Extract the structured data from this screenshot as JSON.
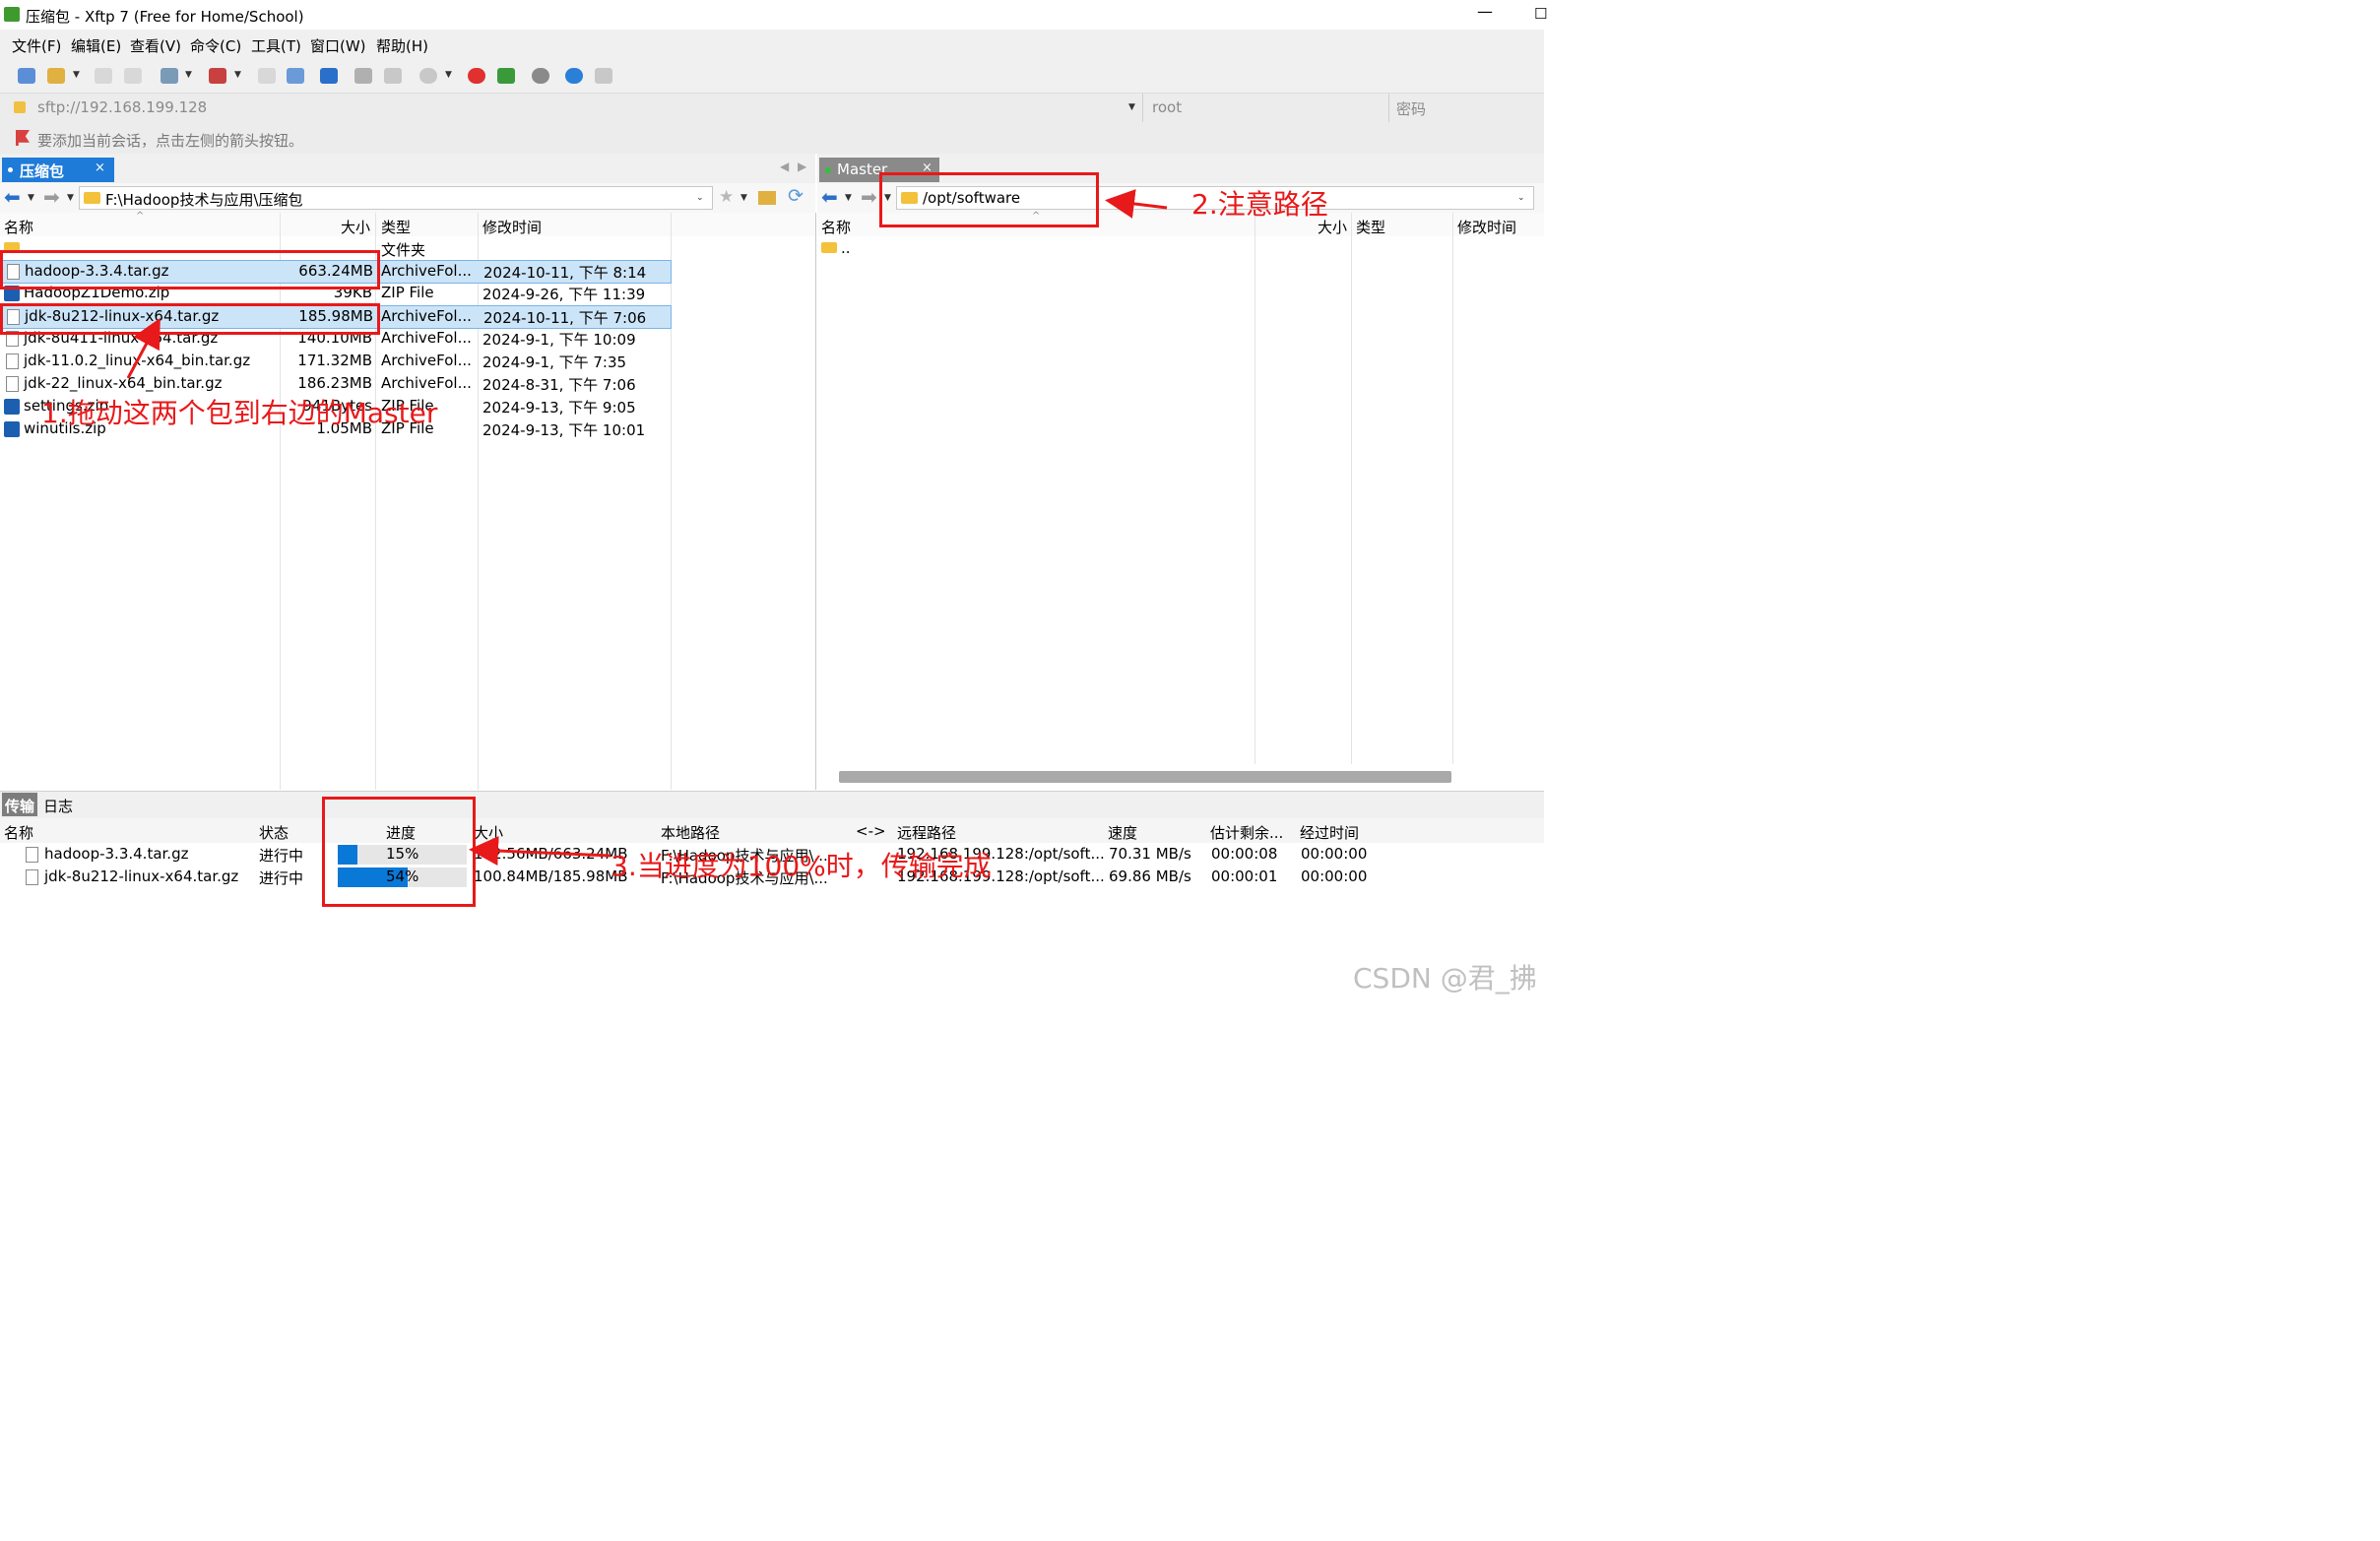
{
  "window": {
    "title": "压缩包 - Xftp 7 (Free for Home/School)",
    "minimize": "—",
    "maximize": "☐"
  },
  "menu": [
    "文件(F)",
    "编辑(E)",
    "查看(V)",
    "命令(C)",
    "工具(T)",
    "窗口(W)",
    "帮助(H)"
  ],
  "toolbar_icons": [
    "new-session-icon",
    "open-folder-icon",
    "connect-icon",
    "disconnect-icon",
    "properties-icon",
    "terminal-icon",
    "open-local-icon",
    "transfer-right-icon",
    "sync-icon",
    "copy-icon",
    "paste-icon",
    "record-icon",
    "xshell-icon",
    "xftp-icon",
    "settings-gear-icon",
    "help-icon",
    "chat-icon"
  ],
  "address": {
    "host": "sftp://192.168.199.128",
    "user_placeholder": "root",
    "password_placeholder": "密码"
  },
  "hint": "要添加当前会话，点击左侧的箭头按钮。",
  "left_tab": {
    "label": "压缩包",
    "close": "×"
  },
  "right_tab": {
    "label": "Master",
    "close": "×"
  },
  "tab_nav": {
    "prev": "◀",
    "next": "▶"
  },
  "left_pane": {
    "path": "F:\\Hadoop技术与应用\\压缩包",
    "columns": {
      "name": "名称",
      "size": "大小",
      "type": "类型",
      "modified": "修改时间"
    },
    "files": [
      {
        "name": "..",
        "size": "",
        "type": "文件夹",
        "modified": "",
        "icon": "folder-icon"
      },
      {
        "name": "hadoop-3.3.4.tar.gz",
        "size": "663.24MB",
        "type": "ArchiveFol...",
        "modified": "2024-10-11, 下午 8:14",
        "icon": "file-icon",
        "selected": true
      },
      {
        "name": "HadoopZ1Demo.zip",
        "size": "39KB",
        "type": "ZIP File",
        "modified": "2024-9-26, 下午 11:39",
        "icon": "zip-icon"
      },
      {
        "name": "jdk-8u212-linux-x64.tar.gz",
        "size": "185.98MB",
        "type": "ArchiveFol...",
        "modified": "2024-10-11, 下午 7:06",
        "icon": "file-icon",
        "selected": true
      },
      {
        "name": "jdk-8u411-linux-x64.tar.gz",
        "size": "140.10MB",
        "type": "ArchiveFol...",
        "modified": "2024-9-1, 下午 10:09",
        "icon": "file-icon"
      },
      {
        "name": "jdk-11.0.2_linux-x64_bin.tar.gz",
        "size": "171.32MB",
        "type": "ArchiveFol...",
        "modified": "2024-9-1, 下午 7:35",
        "icon": "file-icon"
      },
      {
        "name": "jdk-22_linux-x64_bin.tar.gz",
        "size": "186.23MB",
        "type": "ArchiveFol...",
        "modified": "2024-8-31, 下午 7:06",
        "icon": "file-icon"
      },
      {
        "name": "settings.zip",
        "size": "941Bytes",
        "type": "ZIP File",
        "modified": "2024-9-13, 下午 9:05",
        "icon": "zip-icon"
      },
      {
        "name": "winutils.zip",
        "size": "1.05MB",
        "type": "ZIP File",
        "modified": "2024-9-13, 下午 10:01",
        "icon": "zip-icon"
      }
    ]
  },
  "right_pane": {
    "path": "/opt/software",
    "columns": {
      "name": "名称",
      "size": "大小",
      "type": "类型",
      "modified": "修改时间"
    },
    "files": [
      {
        "name": "..",
        "icon": "folder-icon"
      }
    ]
  },
  "transfer": {
    "tabs": [
      "传输",
      "日志"
    ],
    "columns": [
      "名称",
      "状态",
      "进度",
      "大小",
      "本地路径",
      "<->",
      "远程路径",
      "速度",
      "估计剩余...",
      "经过时间"
    ],
    "rows": [
      {
        "name": "hadoop-3.3.4.tar.gz",
        "status": "进行中",
        "progress_pct": 15,
        "progress": "15%",
        "size": "102.56MB/663.24MB",
        "local": "F:\\Hadoop技术与应用\\...",
        "remote": "192.168.199.128:/opt/soft...",
        "speed": "70.31 MB/s",
        "eta": "00:00:08",
        "elapsed": "00:00:00"
      },
      {
        "name": "jdk-8u212-linux-x64.tar.gz",
        "status": "进行中",
        "progress_pct": 54,
        "progress": "54%",
        "size": "100.84MB/185.98MB",
        "local": "F:\\Hadoop技术与应用\\...",
        "remote": "192.168.199.128:/opt/soft...",
        "speed": "69.86 MB/s",
        "eta": "00:00:01",
        "elapsed": "00:00:00"
      }
    ]
  },
  "annotations": {
    "drag_note": "1.拖动这两个包到右边的Master",
    "path_note": "2.注意路径",
    "progress_note": "3.当进度为100%时，传输完成"
  },
  "watermark": "CSDN @君_拂",
  "colors": {
    "accent": "#1f7bd8",
    "annotation": "#e8191a",
    "selection": "#cce4f7",
    "progress": "#0a78d7"
  }
}
